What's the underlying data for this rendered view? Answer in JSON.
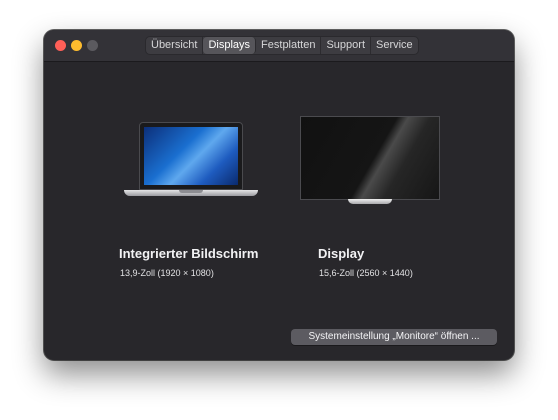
{
  "window": {
    "traffic_lights": {
      "close": "#ff5f57",
      "minimize": "#febc2e",
      "zoom": "#5b5a5f"
    },
    "tabs": [
      {
        "label": "Übersicht",
        "active": false
      },
      {
        "label": "Displays",
        "active": true
      },
      {
        "label": "Festplatten",
        "active": false
      },
      {
        "label": "Support",
        "active": false
      },
      {
        "label": "Service",
        "active": false
      }
    ]
  },
  "displays": [
    {
      "icon": "laptop-icon",
      "name": "Integrierter Bildschirm",
      "spec": "13,9-Zoll (1920 × 1080)"
    },
    {
      "icon": "monitor-icon",
      "name": "Display",
      "spec": "15,6-Zoll (2560 × 1440)"
    }
  ],
  "open_settings_button": "Systemeinstellung „Monitore“ öffnen ..."
}
